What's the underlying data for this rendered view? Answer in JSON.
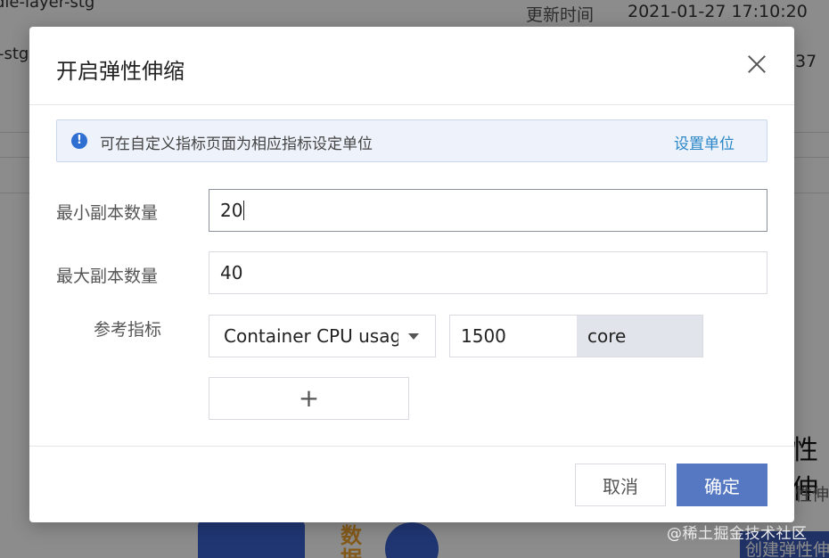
{
  "background": {
    "row1_name": "dle-layer-stg",
    "row2_name": "-stg",
    "update_label": "更新时间",
    "update_value": "2021-01-27 17:10:20",
    "row2_right_num": "37",
    "right_heading": "性伸",
    "right_subtext": "性伸",
    "create_button": "创建弹性伸",
    "illus_text": "数\n据",
    "watermark": "@稀土掘金技术社区"
  },
  "modal": {
    "title": "开启弹性伸缩",
    "alert": {
      "text": "可在自定义指标页面为相应指标设定单位",
      "link": "设置单位",
      "icon": "info-icon"
    },
    "fields": {
      "min_label": "最小副本数量",
      "min_value": "20",
      "max_label": "最大副本数量",
      "max_value": "40",
      "metric_label": "参考指标",
      "metric_select": "Container CPU usage",
      "metric_value": "1500",
      "metric_unit": "core"
    },
    "add_button": "+",
    "buttons": {
      "cancel": "取消",
      "ok": "确定"
    }
  },
  "colors": {
    "primary": "#5677c2",
    "link": "#2a86c7",
    "alert_bg": "#eef3fb"
  }
}
